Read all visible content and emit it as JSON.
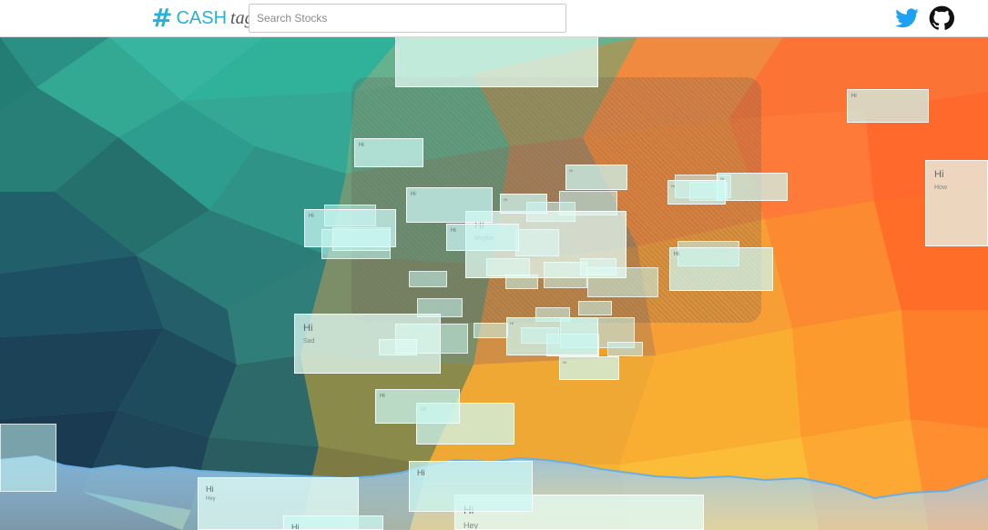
{
  "header": {
    "logo": {
      "hash": "#",
      "cash": "CASH",
      "tag": "tag"
    },
    "search": {
      "placeholder": "Search Stocks",
      "value": ""
    },
    "links": {
      "twitter_icon": "twitter-bird-icon",
      "github_icon": "github-octocat-icon"
    },
    "colors": {
      "accent": "#27b1d9",
      "twitter": "#1da1f2",
      "github": "#111111"
    }
  },
  "tweets": {
    "t_sad": {
      "title": "Hi",
      "body": "Sad"
    },
    "t_maybe": {
      "title": "Hi",
      "body": "Maybe"
    },
    "t_how": {
      "title": "Hi",
      "body": "How"
    },
    "t_hey": {
      "title": "Hi",
      "body": "Hey"
    },
    "t_hey2": {
      "title": "Hi",
      "body": "Hey"
    },
    "t_hi_a": {
      "title": "Hi",
      "body": "Hey"
    },
    "t_hi_b": {
      "title": "Hi",
      "body": ""
    },
    "t_hi_c": {
      "title": "Hi",
      "body": ""
    },
    "t_hi_d": {
      "title": "Hi",
      "body": ""
    },
    "t_hi_e": {
      "title": "Hi",
      "body": ""
    },
    "t_hi_f": {
      "title": "Hi",
      "body": ""
    },
    "t_hi_g": {
      "title": "Hi",
      "body": ""
    },
    "t_hi_h": {
      "title": "Hi",
      "body": ""
    },
    "t_hi_i": {
      "title": "Hi",
      "body": ""
    },
    "t_hi_j": {
      "title": "Hi",
      "body": ""
    },
    "t_hi_k": {
      "title": "Hi",
      "body": ""
    },
    "t_hi_l": {
      "title": "Hi",
      "body": ""
    },
    "t_hi_m": {
      "title": "Hi",
      "body": ""
    },
    "t_hi_n": {
      "title": "Hi",
      "body": ""
    },
    "t_hi_o": {
      "title": "Hi",
      "body": ""
    },
    "t_hi_p": {
      "title": "Hi",
      "body": ""
    }
  }
}
